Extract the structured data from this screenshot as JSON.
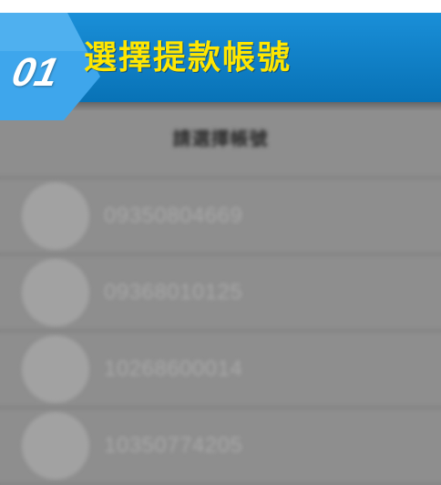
{
  "header": {
    "step_number": "01",
    "step_title": "選擇提款帳號"
  },
  "picker": {
    "title": "請選擇帳號",
    "accounts": [
      {
        "number": "09350804669"
      },
      {
        "number": "09368010125"
      },
      {
        "number": "10268600014"
      },
      {
        "number": "10350774205"
      }
    ]
  },
  "colors": {
    "ribbon": "#0872b6",
    "badge": "#3ea6ec",
    "title_text": "#ffe600",
    "overlay": "#8e8e8e"
  }
}
